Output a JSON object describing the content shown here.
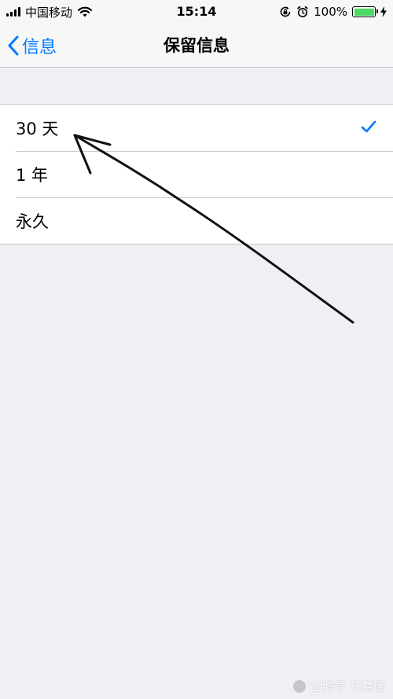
{
  "status_bar": {
    "carrier": "中国移动",
    "time": "15:14",
    "battery_percent": "100%",
    "battery_level": 1.0,
    "battery_color": "#4cd964",
    "icons": [
      "signal-icon",
      "wifi-icon",
      "rotation-lock-icon",
      "alarm-icon",
      "battery-icon",
      "charging-icon"
    ]
  },
  "nav": {
    "back_label": "信息",
    "title": "保留信息",
    "accent_color": "#007aff"
  },
  "options": [
    {
      "label": "30 天",
      "selected": true
    },
    {
      "label": "1 年",
      "selected": false
    },
    {
      "label": "永久",
      "selected": false
    }
  ],
  "watermark": {
    "text": "企鹅号 炫舞瑶"
  }
}
